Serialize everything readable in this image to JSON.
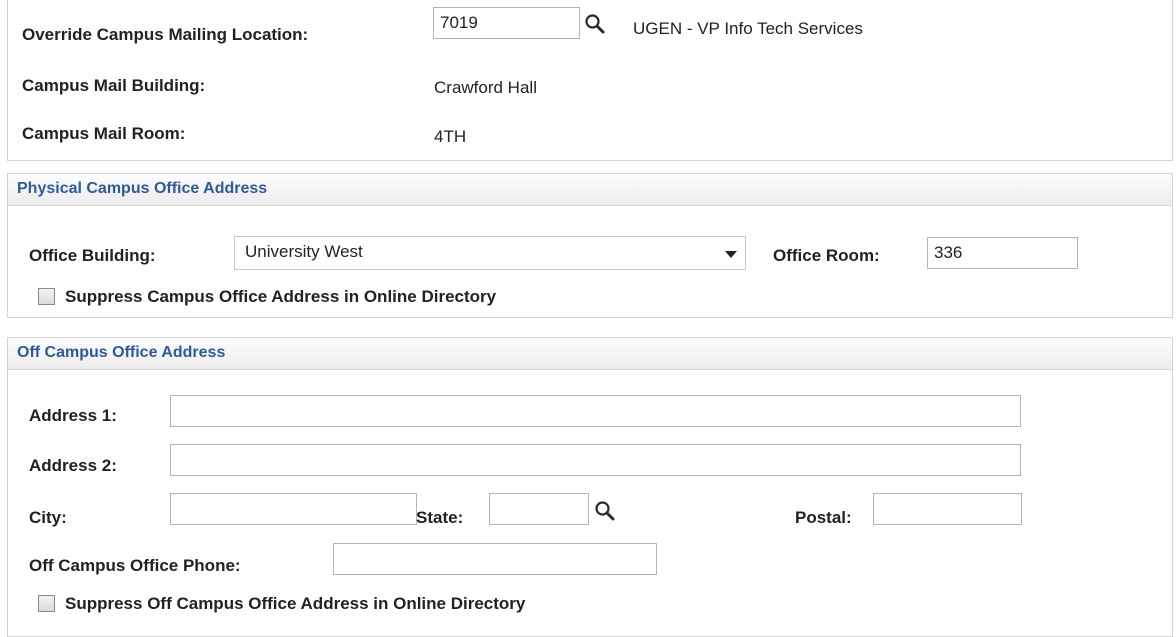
{
  "mailing": {
    "override_label": "Override Campus Mailing Location:",
    "override_value": "7019",
    "override_description": "UGEN - VP Info Tech Services",
    "building_label": "Campus Mail Building:",
    "building_value": "Crawford Hall",
    "room_label": "Campus Mail Room:",
    "room_value": "4TH"
  },
  "physical": {
    "header": "Physical Campus Office Address",
    "building_label": "Office Building:",
    "building_selected": "University West",
    "room_label": "Office Room:",
    "room_value": "336",
    "suppress_label": "Suppress Campus Office Address in Online Directory",
    "suppress_checked": false
  },
  "offcampus": {
    "header": "Off Campus Office Address",
    "address1_label": "Address 1:",
    "address1_value": "",
    "address2_label": "Address 2:",
    "address2_value": "",
    "city_label": "City:",
    "city_value": "",
    "state_label": "State:",
    "state_value": "",
    "postal_label": "Postal:",
    "postal_value": "",
    "phone_label": "Off Campus Office Phone:",
    "phone_value": "",
    "suppress_label": "Suppress Off Campus Office Address in Online Directory",
    "suppress_checked": false
  },
  "icons": {
    "lookup": "magnifier-lookup-icon",
    "dropdown": "chevron-down-icon"
  }
}
